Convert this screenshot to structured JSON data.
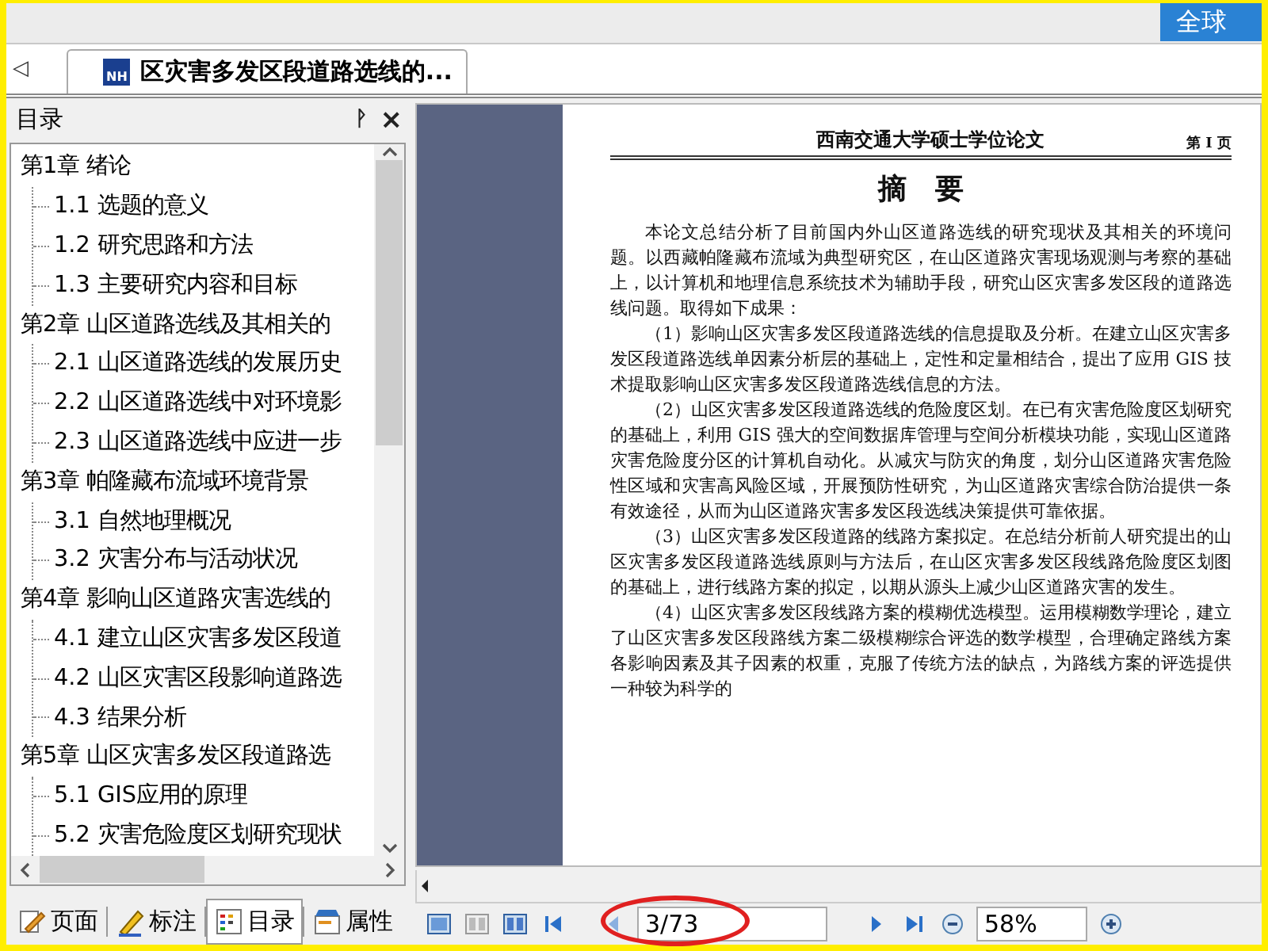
{
  "top_bar": {
    "button": "全球"
  },
  "tab_strip": {
    "back": "◁",
    "tabs": [
      {
        "icon_text": "NH",
        "title": "区灾害多发区段道路选线的...",
        "selected": true
      }
    ]
  },
  "toc_panel": {
    "title": "目录",
    "pin": "ᚹ",
    "close": "×",
    "items": [
      {
        "label": "第1章 绪论",
        "children": [
          {
            "label": "1.1 选题的意义"
          },
          {
            "label": "1.2 研究思路和方法"
          },
          {
            "label": "1.3 主要研究内容和目标"
          }
        ]
      },
      {
        "label": "第2章 山区道路选线及其相关的",
        "children": [
          {
            "label": "2.1 山区道路选线的发展历史"
          },
          {
            "label": "2.2 山区道路选线中对环境影"
          },
          {
            "label": "2.3 山区道路选线中应进一步"
          }
        ]
      },
      {
        "label": "第3章 帕隆藏布流域环境背景",
        "children": [
          {
            "label": "3.1 自然地理概况"
          },
          {
            "label": "3.2 灾害分布与活动状况"
          }
        ]
      },
      {
        "label": "第4章 影响山区道路灾害选线的",
        "children": [
          {
            "label": "4.1 建立山区灾害多发区段道"
          },
          {
            "label": "4.2 山区灾害区段影响道路选"
          },
          {
            "label": "4.3 结果分析"
          }
        ]
      },
      {
        "label": "第5章 山区灾害多发区段道路选",
        "children": [
          {
            "label": "5.1 GIS应用的原理"
          },
          {
            "label": "5.2 灾害危险度区划研究现状"
          }
        ]
      }
    ],
    "bottom_tabs": [
      {
        "kind": "page",
        "label": "页面",
        "selected": false
      },
      {
        "kind": "note",
        "label": "标注",
        "selected": false
      },
      {
        "kind": "toc",
        "label": "目录",
        "selected": true
      },
      {
        "kind": "props",
        "label": "属性",
        "selected": false
      }
    ]
  },
  "document": {
    "running_head": "西南交通大学硕士学位论文",
    "page_label": "第 I 页",
    "title": "摘　要",
    "paragraphs": [
      "本论文总结分析了目前国内外山区道路选线的研究现状及其相关的环境问题。以西藏帕隆藏布流域为典型研究区，在山区道路灾害现场观测与考察的基础上，以计算机和地理信息系统技术为辅助手段，研究山区灾害多发区段的道路选线问题。取得如下成果：",
      "（1）影响山区灾害多发区段道路选线的信息提取及分析。在建立山区灾害多发区段道路选线单因素分析层的基础上，定性和定量相结合，提出了应用 GIS 技术提取影响山区灾害多发区段道路选线信息的方法。",
      "（2）山区灾害多发区段道路选线的危险度区划。在已有灾害危险度区划研究的基础上，利用 GIS 强大的空间数据库管理与空间分析模块功能，实现山区道路灾害危险度分区的计算机自动化。从减灾与防灾的角度，划分山区道路灾害危险性区域和灾害高风险区域，开展预防性研究，为山区道路灾害综合防治提供一条有效途径，从而为山区道路灾害多发区段选线决策提供可靠依据。",
      "（3）山区灾害多发区段道路的线路方案拟定。在总结分析前人研究提出的山区灾害多发区段道路选线原则与方法后，在山区灾害多发区段线路危险度区划图的基础上，进行线路方案的拟定，以期从源头上减少山区道路灾害的发生。",
      "（4）山区灾害多发区段线路方案的模糊优选模型。运用模糊数学理论，建立了山区灾害多发区段路线方案二级模糊综合评选的数学模型，合理确定路线方案各影响因素及其子因素的权重，克服了传统方法的缺点，为路线方案的评选提供一种较为科学的"
    ]
  },
  "toolbar": {
    "page_field": "3/73",
    "page_field_circled": true,
    "zoom_field": "58%"
  }
}
